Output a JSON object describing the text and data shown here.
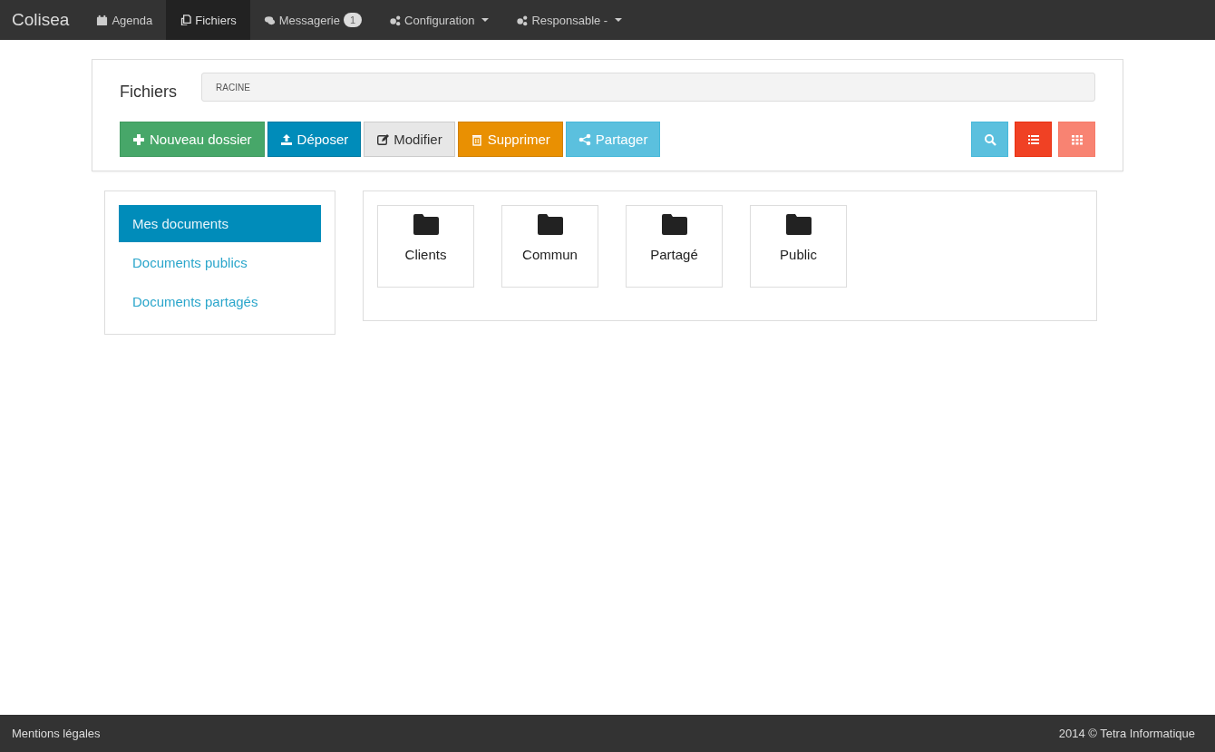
{
  "navbar": {
    "brand": "Colisea",
    "items": [
      {
        "label": "Agenda",
        "selected": false,
        "dropdown": false
      },
      {
        "label": "Fichiers",
        "selected": true,
        "dropdown": false
      },
      {
        "label": "Messagerie",
        "selected": false,
        "dropdown": false,
        "badge": "1"
      },
      {
        "label": "Configuration",
        "selected": false,
        "dropdown": true
      },
      {
        "label": "Responsable -",
        "selected": false,
        "dropdown": true
      }
    ]
  },
  "panel": {
    "title": "Fichiers",
    "path": "RACINE",
    "actions": [
      {
        "label": "Nouveau dossier"
      },
      {
        "label": "Déposer"
      },
      {
        "label": "Modifier"
      },
      {
        "label": "Supprimer"
      },
      {
        "label": "Partager"
      }
    ],
    "views": [
      {
        "selected": false
      },
      {
        "selected": true
      },
      {
        "selected": false
      }
    ]
  },
  "sidebar": {
    "items": [
      {
        "label": "Mes documents",
        "selected": true
      },
      {
        "label": "Documents publics",
        "selected": false
      },
      {
        "label": "Documents partagés",
        "selected": false
      }
    ]
  },
  "folders": [
    {
      "name": "Clients"
    },
    {
      "name": "Commun"
    },
    {
      "name": "Partagé"
    },
    {
      "name": "Public"
    }
  ],
  "footer": {
    "left": "Mentions légales",
    "right": "2014 © Tetra Informatique"
  }
}
